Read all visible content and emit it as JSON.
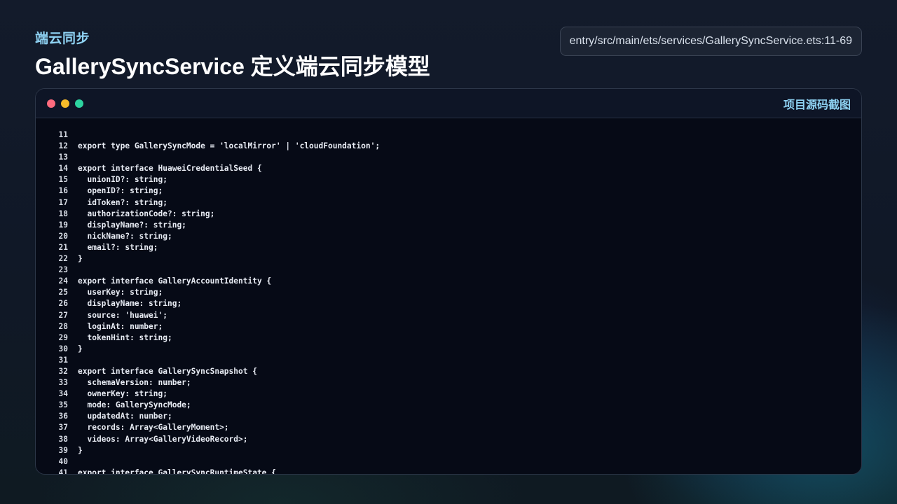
{
  "header": {
    "eyebrow": "端云同步",
    "title": "GallerySyncService 定义端云同步模型",
    "source_path": "entry/src/main/ets/services/GallerySyncService.ets:11-69"
  },
  "window": {
    "label": "项目源码截图",
    "traffic_lights": [
      "#ff6b7e",
      "#f7bb2a",
      "#2dd4a0"
    ]
  },
  "code": {
    "lines": [
      {
        "n": "11",
        "text": ""
      },
      {
        "n": "12",
        "text": "export type GallerySyncMode = 'localMirror' | 'cloudFoundation';"
      },
      {
        "n": "13",
        "text": ""
      },
      {
        "n": "14",
        "text": "export interface HuaweiCredentialSeed {"
      },
      {
        "n": "15",
        "text": "  unionID?: string;"
      },
      {
        "n": "16",
        "text": "  openID?: string;"
      },
      {
        "n": "17",
        "text": "  idToken?: string;"
      },
      {
        "n": "18",
        "text": "  authorizationCode?: string;"
      },
      {
        "n": "19",
        "text": "  displayName?: string;"
      },
      {
        "n": "20",
        "text": "  nickName?: string;"
      },
      {
        "n": "21",
        "text": "  email?: string;"
      },
      {
        "n": "22",
        "text": "}"
      },
      {
        "n": "23",
        "text": ""
      },
      {
        "n": "24",
        "text": "export interface GalleryAccountIdentity {"
      },
      {
        "n": "25",
        "text": "  userKey: string;"
      },
      {
        "n": "26",
        "text": "  displayName: string;"
      },
      {
        "n": "27",
        "text": "  source: 'huawei';"
      },
      {
        "n": "28",
        "text": "  loginAt: number;"
      },
      {
        "n": "29",
        "text": "  tokenHint: string;"
      },
      {
        "n": "30",
        "text": "}"
      },
      {
        "n": "31",
        "text": ""
      },
      {
        "n": "32",
        "text": "export interface GallerySyncSnapshot {"
      },
      {
        "n": "33",
        "text": "  schemaVersion: number;"
      },
      {
        "n": "34",
        "text": "  ownerKey: string;"
      },
      {
        "n": "35",
        "text": "  mode: GallerySyncMode;"
      },
      {
        "n": "36",
        "text": "  updatedAt: number;"
      },
      {
        "n": "37",
        "text": "  records: Array<GalleryMoment>;"
      },
      {
        "n": "38",
        "text": "  videos: Array<GalleryVideoRecord>;"
      },
      {
        "n": "39",
        "text": "}"
      },
      {
        "n": "40",
        "text": ""
      },
      {
        "n": "41",
        "text": "export interface GallerySyncRuntimeState {"
      }
    ]
  }
}
